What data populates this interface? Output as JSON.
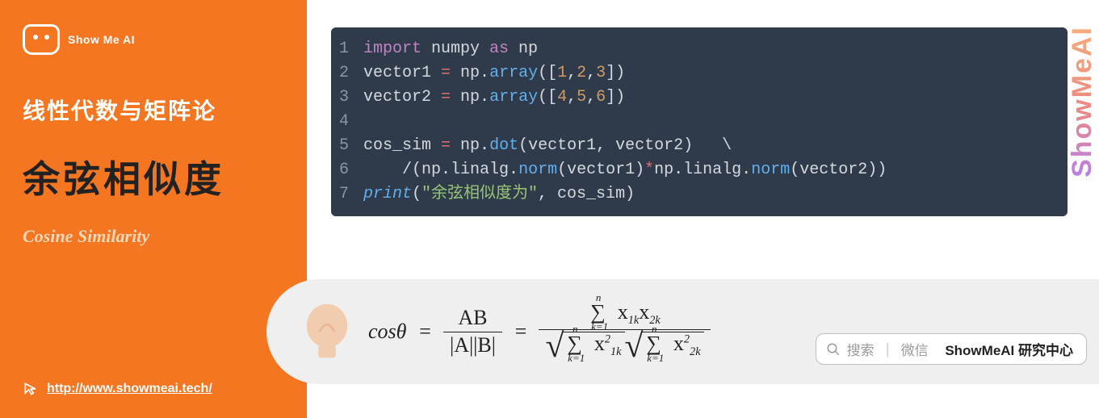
{
  "sidebar": {
    "logo_text": "Show Me AI",
    "subtitle": "线性代数与矩阵论",
    "title": "余弦相似度",
    "title_en": "Cosine Similarity",
    "url": "http://www.showmeai.tech/"
  },
  "code": {
    "lines": [
      {
        "n": "1",
        "tokens": [
          {
            "t": "import",
            "c": "kw-imp"
          },
          {
            "t": " numpy ",
            "c": "kw-var"
          },
          {
            "t": "as",
            "c": "kw-imp"
          },
          {
            "t": " np",
            "c": "kw-var"
          }
        ]
      },
      {
        "n": "2",
        "tokens": [
          {
            "t": "vector1 ",
            "c": "kw-var"
          },
          {
            "t": "=",
            "c": "op"
          },
          {
            "t": " np",
            "c": "kw-var"
          },
          {
            "t": ".",
            "c": "pun"
          },
          {
            "t": "array",
            "c": "fn"
          },
          {
            "t": "([",
            "c": "pun"
          },
          {
            "t": "1",
            "c": "num"
          },
          {
            "t": ",",
            "c": "pun"
          },
          {
            "t": "2",
            "c": "num"
          },
          {
            "t": ",",
            "c": "pun"
          },
          {
            "t": "3",
            "c": "num"
          },
          {
            "t": "])",
            "c": "pun"
          }
        ]
      },
      {
        "n": "3",
        "tokens": [
          {
            "t": "vector2 ",
            "c": "kw-var"
          },
          {
            "t": "=",
            "c": "op"
          },
          {
            "t": " np",
            "c": "kw-var"
          },
          {
            "t": ".",
            "c": "pun"
          },
          {
            "t": "array",
            "c": "fn"
          },
          {
            "t": "([",
            "c": "pun"
          },
          {
            "t": "4",
            "c": "num"
          },
          {
            "t": ",",
            "c": "pun"
          },
          {
            "t": "5",
            "c": "num"
          },
          {
            "t": ",",
            "c": "pun"
          },
          {
            "t": "6",
            "c": "num"
          },
          {
            "t": "])",
            "c": "pun"
          }
        ]
      },
      {
        "n": "4",
        "tokens": []
      },
      {
        "n": "5",
        "tokens": [
          {
            "t": "cos_sim ",
            "c": "kw-var"
          },
          {
            "t": "=",
            "c": "op"
          },
          {
            "t": " np",
            "c": "kw-var"
          },
          {
            "t": ".",
            "c": "pun"
          },
          {
            "t": "dot",
            "c": "fn"
          },
          {
            "t": "(vector1, vector2)   \\",
            "c": "pun"
          }
        ]
      },
      {
        "n": "6",
        "tokens": [
          {
            "t": "    /(np",
            "c": "kw-var"
          },
          {
            "t": ".",
            "c": "pun"
          },
          {
            "t": "linalg",
            "c": "kw-var"
          },
          {
            "t": ".",
            "c": "pun"
          },
          {
            "t": "norm",
            "c": "fn"
          },
          {
            "t": "(vector1)",
            "c": "pun"
          },
          {
            "t": "*",
            "c": "op"
          },
          {
            "t": "np",
            "c": "kw-var"
          },
          {
            "t": ".",
            "c": "pun"
          },
          {
            "t": "linalg",
            "c": "kw-var"
          },
          {
            "t": ".",
            "c": "pun"
          },
          {
            "t": "norm",
            "c": "fn"
          },
          {
            "t": "(vector2))",
            "c": "pun"
          }
        ]
      },
      {
        "n": "7",
        "tokens": [
          {
            "t": "print",
            "c": "fn-it"
          },
          {
            "t": "(",
            "c": "pun"
          },
          {
            "t": "\"余弦相似度为\"",
            "c": "str"
          },
          {
            "t": ", cos_sim)",
            "c": "pun"
          }
        ]
      }
    ]
  },
  "formula": {
    "lhs": "cosθ",
    "frac1_top": "AB",
    "frac1_bot": "|A||B|",
    "eq": "=",
    "sum_symbol": "∑",
    "lim_top": "n",
    "lim_bot": "k=1",
    "x1": "x",
    "sub1": "1k",
    "sub2": "2k",
    "sq": "2"
  },
  "search": {
    "placeholder": "搜索",
    "divider": "｜",
    "hint": "微信",
    "brand": "ShowMeAI 研究中心"
  },
  "watermark": "ShowMeAI"
}
